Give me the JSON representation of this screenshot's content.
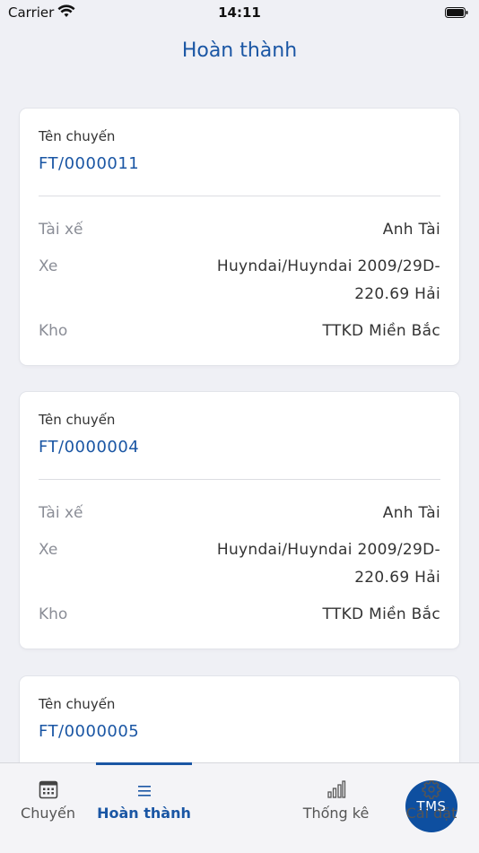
{
  "status_bar": {
    "carrier": "Carrier",
    "time": "14:11"
  },
  "header": {
    "title": "Hoàn thành"
  },
  "cards": [
    {
      "trip_label": "Tên chuyến",
      "trip_code": "FT/0000011",
      "driver_label": "Tài xế",
      "driver_value": "Anh Tài",
      "vehicle_label": "Xe",
      "vehicle_value": "Huyndai/Huyndai 2009/29D-220.69 Hải",
      "warehouse_label": "Kho",
      "warehouse_value": "TTKD Miền Bắc"
    },
    {
      "trip_label": "Tên chuyến",
      "trip_code": "FT/0000004",
      "driver_label": "Tài xế",
      "driver_value": "Anh Tài",
      "vehicle_label": "Xe",
      "vehicle_value": "Huyndai/Huyndai 2009/29D-220.69 Hải",
      "warehouse_label": "Kho",
      "warehouse_value": "TTKD Miền Bắc"
    },
    {
      "trip_label": "Tên chuyến",
      "trip_code": "FT/0000005"
    }
  ],
  "tabbar": {
    "tabs": [
      {
        "label": "Chuyến",
        "icon": "calendar-icon"
      },
      {
        "label": "Hoàn thành",
        "icon": "list-icon"
      },
      {
        "label": "TMS",
        "icon": "tms-center-button"
      },
      {
        "label": "Thống kê",
        "icon": "bar-chart-icon"
      },
      {
        "label": "Cài đặt",
        "icon": "gear-icon"
      }
    ],
    "active_index": 1
  },
  "colors": {
    "accent": "#1a56a4",
    "center_button": "#0e4fa0",
    "background": "#eff0f5"
  }
}
